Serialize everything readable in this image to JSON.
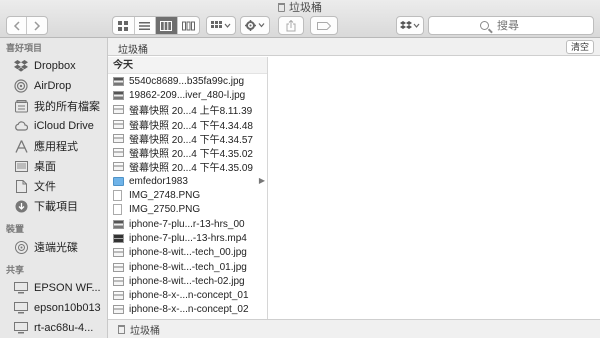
{
  "window": {
    "title": "垃圾桶"
  },
  "toolbar": {
    "back_icon": "chevron-left-icon",
    "forward_icon": "chevron-right-icon",
    "view_modes": [
      "icon-view",
      "list-view",
      "column-view",
      "gallery-view"
    ],
    "active_view": "column-view",
    "search_placeholder": "搜尋"
  },
  "sidebar": {
    "favorites_header": "喜好項目",
    "favorites": [
      {
        "label": "Dropbox",
        "icon": "dropbox-icon"
      },
      {
        "label": "AirDrop",
        "icon": "airdrop-icon"
      },
      {
        "label": "我的所有檔案",
        "icon": "all-files-icon"
      },
      {
        "label": "iCloud Drive",
        "icon": "cloud-icon"
      },
      {
        "label": "應用程式",
        "icon": "applications-icon"
      },
      {
        "label": "桌面",
        "icon": "desktop-icon"
      },
      {
        "label": "文件",
        "icon": "document-icon"
      },
      {
        "label": "下載項目",
        "icon": "download-icon"
      }
    ],
    "devices_header": "裝置",
    "devices": [
      {
        "label": "遠端光碟",
        "icon": "disc-icon"
      }
    ],
    "shared_header": "共享",
    "shared": [
      {
        "label": "EPSON WF...",
        "icon": "computer-icon"
      },
      {
        "label": "epson10b013",
        "icon": "computer-icon"
      },
      {
        "label": "rt-ac68u-4...",
        "icon": "computer-icon"
      }
    ]
  },
  "pathbar": {
    "title": "垃圾桶",
    "empty_button": "清空"
  },
  "column": {
    "header": "今天",
    "files": [
      {
        "name": "5540c8689...b35fa99c.jpg",
        "kind": "img"
      },
      {
        "name": "19862-209...iver_480-l.jpg",
        "kind": "img"
      },
      {
        "name": "螢幕快照 20...4 上午8.11.39",
        "kind": "shot"
      },
      {
        "name": "螢幕快照 20...4 下午4.34.48",
        "kind": "shot"
      },
      {
        "name": "螢幕快照 20...4 下午4.34.57",
        "kind": "shot"
      },
      {
        "name": "螢幕快照 20...4 下午4.35.02",
        "kind": "shot"
      },
      {
        "name": "螢幕快照 20...4 下午4.35.09",
        "kind": "shot"
      },
      {
        "name": "emfedor1983",
        "kind": "folder"
      },
      {
        "name": "IMG_2748.PNG",
        "kind": "png"
      },
      {
        "name": "IMG_2750.PNG",
        "kind": "png"
      },
      {
        "name": "iphone-7-plu...r-13-hrs_00",
        "kind": "img"
      },
      {
        "name": "iphone-7-plu...-13-hrs.mp4",
        "kind": "mp4"
      },
      {
        "name": "iphone-8-wit...-tech_00.jpg",
        "kind": "shot"
      },
      {
        "name": "iphone-8-wit...-tech_01.jpg",
        "kind": "shot"
      },
      {
        "name": "iphone-8-wit...-tech-02.jpg",
        "kind": "shot"
      },
      {
        "name": "iphone-8-x-...n-concept_01",
        "kind": "shot"
      },
      {
        "name": "iphone-8-x-...n-concept_02",
        "kind": "shot"
      }
    ]
  },
  "statusbar": {
    "path": "垃圾桶"
  }
}
